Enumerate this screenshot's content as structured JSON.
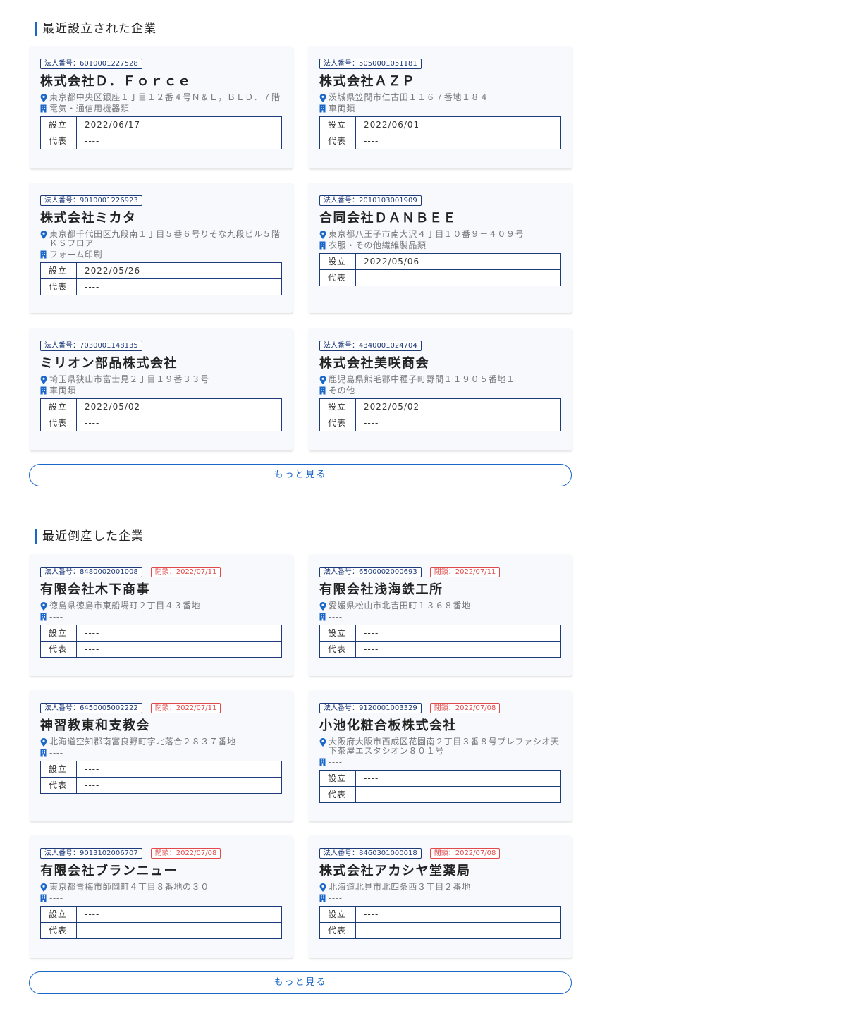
{
  "sections": [
    {
      "title": "最近設立された企業",
      "more_label": "もっと見る",
      "companies": [
        {
          "number": "法人番号：6010001227528",
          "closed": "",
          "name": "株式会社Ｄ．Ｆｏｒｃｅ",
          "address": "東京都中央区銀座１丁目１２番４号Ｎ＆Ｅ，ＢＬＤ．７階",
          "industry": "電気・通信用機器類",
          "established": "2022/06/17",
          "representative": "----"
        },
        {
          "number": "法人番号：5050001051181",
          "closed": "",
          "name": "株式会社ＡＺＰ",
          "address": "茨城県笠間市仁古田１１６７番地１８４",
          "industry": "車両類",
          "established": "2022/06/01",
          "representative": "----"
        },
        {
          "number": "法人番号：9010001226923",
          "closed": "",
          "name": "株式会社ミカタ",
          "address": "東京都千代田区九段南１丁目５番６号りそな九段ビル５階ＫＳフロア",
          "industry": "フォーム印刷",
          "established": "2022/05/26",
          "representative": "----"
        },
        {
          "number": "法人番号：2010103001909",
          "closed": "",
          "name": "合同会社ＤＡＮＢＥＥ",
          "address": "東京都八王子市南大沢４丁目１０番９－４０９号",
          "industry": "衣服・その他繊維製品類",
          "established": "2022/05/06",
          "representative": "----"
        },
        {
          "number": "法人番号：7030001148135",
          "closed": "",
          "name": "ミリオン部品株式会社",
          "address": "埼玉県狭山市富士見２丁目１９番３３号",
          "industry": "車両類",
          "established": "2022/05/02",
          "representative": "----"
        },
        {
          "number": "法人番号：4340001024704",
          "closed": "",
          "name": "株式会社美咲商会",
          "address": "鹿児島県熊毛郡中種子町野間１１９０５番地１",
          "industry": "その他",
          "established": "2022/05/02",
          "representative": "----"
        }
      ]
    },
    {
      "title": "最近倒産した企業",
      "more_label": "もっと見る",
      "companies": [
        {
          "number": "法人番号：8480002001008",
          "closed": "閉鎖：2022/07/11",
          "name": "有限会社木下商事",
          "address": "徳島県徳島市東船場町２丁目４３番地",
          "industry": "----",
          "established": "----",
          "representative": "----"
        },
        {
          "number": "法人番号：6500002000693",
          "closed": "閉鎖：2022/07/11",
          "name": "有限会社浅海鉄工所",
          "address": "愛媛県松山市北吉田町１３６８番地",
          "industry": "----",
          "established": "----",
          "representative": "----"
        },
        {
          "number": "法人番号：6450005002222",
          "closed": "閉鎖：2022/07/11",
          "name": "神習教東和支教会",
          "address": "北海道空知郡南富良野町字北落合２８３７番地",
          "industry": "----",
          "established": "----",
          "representative": "----"
        },
        {
          "number": "法人番号：9120001003329",
          "closed": "閉鎖：2022/07/08",
          "name": "小池化粧合板株式会社",
          "address": "大阪府大阪市西成区花園南２丁目３番８号プレファシオ天下茶屋エスタシオン８０１号",
          "industry": "----",
          "established": "----",
          "representative": "----"
        },
        {
          "number": "法人番号：9013102006707",
          "closed": "閉鎖：2022/07/08",
          "name": "有限会社ブランニュー",
          "address": "東京都青梅市師岡町４丁目８番地の３０",
          "industry": "----",
          "established": "----",
          "representative": "----"
        },
        {
          "number": "法人番号：8460301000018",
          "closed": "閉鎖：2022/07/08",
          "name": "株式会社アカシヤ堂薬局",
          "address": "北海道北見市北四条西３丁目２番地",
          "industry": "----",
          "established": "----",
          "representative": "----"
        }
      ]
    }
  ],
  "labels": {
    "established": "設立",
    "representative": "代表"
  },
  "colors": {
    "accent": "#1a66c9",
    "navy": "#1d3a7a",
    "closed": "#e04a4a"
  },
  "icons": {
    "address": "map-pin-icon",
    "industry": "building-icon"
  }
}
